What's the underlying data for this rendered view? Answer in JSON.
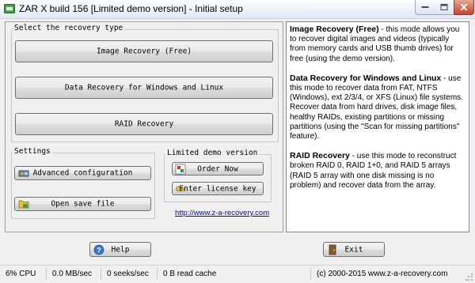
{
  "window": {
    "title": "ZAR X build 156 [Limited demo version] - Initial setup"
  },
  "recovery": {
    "group_label": "Select the recovery type",
    "image_button": "Image Recovery (Free)",
    "data_button": "Data Recovery for Windows and Linux",
    "raid_button": "RAID Recovery"
  },
  "settings": {
    "group_label": "Settings",
    "advanced_button": "Advanced configuration",
    "open_save_button": "Open save file"
  },
  "demo": {
    "group_label": "Limited demo version",
    "order_button": "Order Now",
    "license_button": "Enter license key",
    "link": "http://www.z-a-recovery.com"
  },
  "description": {
    "image_title": "Image Recovery (Free)",
    "image_text": " - this mode allows you to recover digital images and videos (typically from memory cards and USB thumb drives) for free (using the demo version).",
    "data_title": "Data Recovery for Windows and Linux",
    "data_text": " - use this mode to recover data from FAT, NTFS (Windows), ext 2/3/4, or XFS (Linux) file systems. Recover data from hard drives, disk image files, healthy RAIDs, existing partitions or missing partitions (using the \"Scan for missing partitions\" feature).",
    "raid_title": "RAID Recovery",
    "raid_text": " - use this mode to reconstruct broken RAID 0, RAID 1+0, and RAID 5 arrays (RAID 5 array with one disk missing is no problem) and recover data from the array."
  },
  "footer": {
    "help_button": "Help",
    "exit_button": "Exit"
  },
  "status": {
    "cpu": "6% CPU",
    "speed": "0.0 MB/sec",
    "seeks": "0 seeks/sec",
    "cache": "0 B read cache",
    "copyright": "(c) 2000-2015 www.z-a-recovery.com"
  }
}
